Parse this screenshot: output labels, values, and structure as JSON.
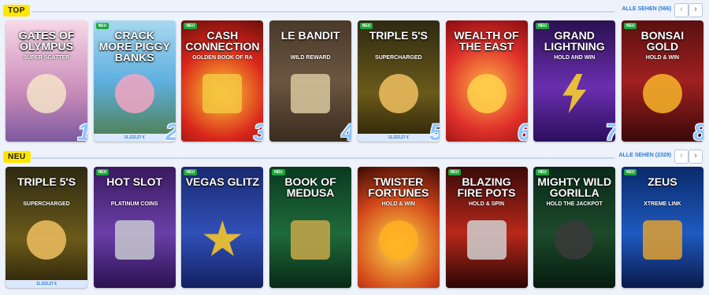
{
  "sections": {
    "top": {
      "label": "TOP",
      "see_all": "ALLE SEHEN (566)",
      "prev": "‹",
      "next": "›"
    },
    "new": {
      "label": "NEU",
      "see_all": "ALLE SEHEN (2329)",
      "prev": "‹",
      "next": "›"
    }
  },
  "top_games": [
    {
      "title": "Gates of Olympus",
      "sub": "SUPER SCATTER",
      "rank": "1",
      "new": "",
      "jackpot": ""
    },
    {
      "title": "Crack more Piggy Banks",
      "sub": "",
      "rank": "2",
      "new": "NEU",
      "jackpot": "11.222,27 €"
    },
    {
      "title": "Cash Connection",
      "sub": "GOLDEN BOOK OF RA",
      "rank": "3",
      "new": "NEU",
      "jackpot": ""
    },
    {
      "title": "Le Bandit",
      "sub": "WILD REWARD",
      "rank": "4",
      "new": "",
      "jackpot": ""
    },
    {
      "title": "Triple 5's",
      "sub": "SUPERCHARGED",
      "rank": "5",
      "new": "NEU",
      "jackpot": "11.222,27 €"
    },
    {
      "title": "Wealth of the East",
      "sub": "",
      "rank": "6",
      "new": "",
      "jackpot": ""
    },
    {
      "title": "Grand Lightning",
      "sub": "HOLD AND WIN",
      "rank": "7",
      "new": "NEU",
      "jackpot": ""
    },
    {
      "title": "Bonsai Gold",
      "sub": "HOLD & WIN",
      "rank": "8",
      "new": "NEU",
      "jackpot": ""
    }
  ],
  "new_games": [
    {
      "title": "Triple 5's",
      "sub": "SUPERCHARGED",
      "new": "",
      "jackpot": "11.222,27 €"
    },
    {
      "title": "Hot Slot",
      "sub": "PLATINUM COINS",
      "new": "NEU",
      "jackpot": ""
    },
    {
      "title": "Vegas Glitz",
      "sub": "",
      "new": "NEU",
      "jackpot": ""
    },
    {
      "title": "Book of Medusa",
      "sub": "",
      "new": "NEU",
      "jackpot": ""
    },
    {
      "title": "Twister Fortunes",
      "sub": "HOLD & WIN",
      "new": "",
      "jackpot": ""
    },
    {
      "title": "Blazing Fire Pots",
      "sub": "HOLD & SPIN",
      "new": "NEU",
      "jackpot": ""
    },
    {
      "title": "Mighty Wild Gorilla",
      "sub": "HOLD THE JACKPOT",
      "new": "NEU",
      "jackpot": ""
    },
    {
      "title": "Zeus",
      "sub": "XTREME LINK",
      "new": "NEU",
      "jackpot": ""
    }
  ]
}
